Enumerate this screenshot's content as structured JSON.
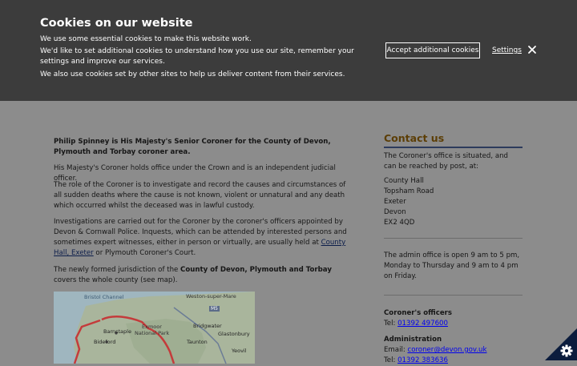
{
  "cookie_banner": {
    "title": "Cookies on our website",
    "line1": "We use some essential cookies to make this website work.",
    "line2": "We'd like to set additional cookies to understand how you use our site, remember your settings and improve our services.",
    "line3": "We also use cookies set by other sites to help us deliver content from their services.",
    "accept_label": "Accept additional cookies",
    "settings_label": "Settings",
    "close_icon": "close-icon"
  },
  "main": {
    "intro": "Philip Spinney is His Majesty's Senior Coroner for the County of Devon, Plymouth and Torbay coroner area.",
    "p1": "His Majesty's Coroner holds office under the Crown and is an independent judicial officer.",
    "p2": "The role of the Coroner is to investigate and record the causes and circumstances of all sudden deaths where the cause is not known, violent or unnatural and any death which occurred whilst the deceased was in lawful custody.",
    "p3_before": "Investigations are carried out for the Coroner by the coroner's officers appointed by Devon & Cornwall Police. Inquests, which can be attended by interested persons and sometimes expert witnesses, either in person or virtually, are usually held at ",
    "p3_link": "County Hall, Exeter",
    "p3_after": " or Plymouth Coroner's Court.",
    "p4_before": "The newly formed jurisdiction of the ",
    "p4_bold": "County of Devon, Plymouth and Torbay",
    "p4_after": " covers the whole county (see map).",
    "map_labels": {
      "bristol_channel": "Bristol Channel",
      "weston": "Weston-super-Mare",
      "exmoor": "Exmoor",
      "national_park": "National Park",
      "barnstaple": "Barnstaple",
      "bideford": "Bideford",
      "bridgwater": "Bridgwater",
      "glastonbury": "Glastonbury",
      "taunton": "Taunton",
      "yeovil": "Yeovil",
      "road_m5": "M5"
    }
  },
  "sidebar": {
    "heading": "Contact us",
    "situated": "The Coroner's office is situated, and can be reached by post, at:",
    "address": [
      "County Hall",
      "Topsham Road",
      "Exeter",
      "Devon",
      "EX2 4QD"
    ],
    "hours": "The admin office is open 9 am to 5 pm, Monday to Thursday and 9 am to 4 pm on Friday.",
    "officers_title": "Coroner's officers",
    "officers_tel_label": "Tel: ",
    "officers_tel": "01392 497600",
    "admin_title": "Administration",
    "admin_email_label": "Email: ",
    "admin_email": "coroner@devon.gov.uk",
    "admin_tel_label": "Tel: ",
    "admin_tel": "01392 383636"
  },
  "cookie_settings_icon": "gear-icon"
}
